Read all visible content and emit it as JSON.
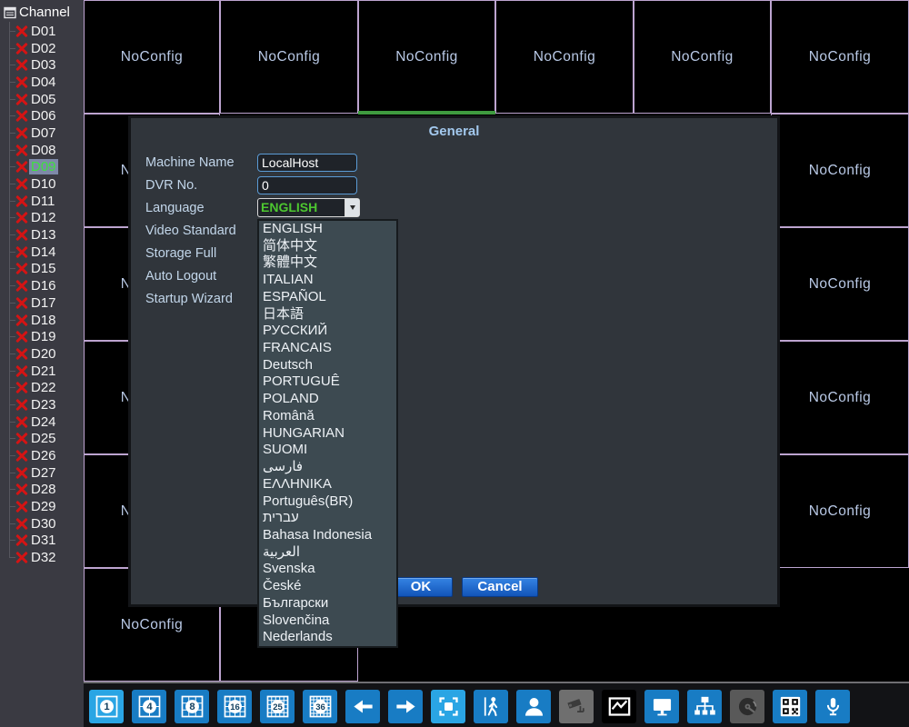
{
  "sidebar": {
    "title": "Channel",
    "selected": "D09",
    "channels": [
      "D01",
      "D02",
      "D03",
      "D04",
      "D05",
      "D06",
      "D07",
      "D08",
      "D09",
      "D10",
      "D11",
      "D12",
      "D13",
      "D14",
      "D15",
      "D16",
      "D17",
      "D18",
      "D19",
      "D20",
      "D21",
      "D22",
      "D23",
      "D24",
      "D25",
      "D26",
      "D27",
      "D28",
      "D29",
      "D30",
      "D31",
      "D32"
    ]
  },
  "grid": {
    "no_config_label": "NoConfig",
    "selected_cell": {
      "r": 2,
      "c": 3
    },
    "cells": [
      {
        "r": 1,
        "c": 1,
        "label": true
      },
      {
        "r": 1,
        "c": 2,
        "label": true
      },
      {
        "r": 1,
        "c": 3,
        "label": true
      },
      {
        "r": 1,
        "c": 4,
        "label": true
      },
      {
        "r": 1,
        "c": 5,
        "label": true
      },
      {
        "r": 1,
        "c": 6,
        "label": true
      },
      {
        "r": 2,
        "c": 1,
        "label": true
      },
      {
        "r": 2,
        "c": 6,
        "label": true
      },
      {
        "r": 3,
        "c": 1,
        "label": true
      },
      {
        "r": 3,
        "c": 6,
        "label": true
      },
      {
        "r": 4,
        "c": 1,
        "label": true
      },
      {
        "r": 4,
        "c": 6,
        "label": true
      },
      {
        "r": 5,
        "c": 1,
        "label": true
      },
      {
        "r": 5,
        "c": 6,
        "label": true
      },
      {
        "r": 6,
        "c": 1,
        "label": true
      },
      {
        "r": 6,
        "c": 2,
        "label": false
      }
    ]
  },
  "dialog": {
    "title": "General",
    "fields": [
      {
        "name": "machine-name",
        "label": "Machine Name",
        "type": "input",
        "value": "LocalHost"
      },
      {
        "name": "dvr-no",
        "label": "DVR No.",
        "type": "input",
        "value": "0"
      },
      {
        "name": "language",
        "label": "Language",
        "type": "combo",
        "value": "ENGLISH"
      },
      {
        "name": "video-standard",
        "label": "Video Standard",
        "type": "hidden"
      },
      {
        "name": "storage-full",
        "label": "Storage Full",
        "type": "hidden"
      },
      {
        "name": "auto-logout",
        "label": "Auto Logout",
        "type": "hidden"
      },
      {
        "name": "startup-wizard",
        "label": "Startup Wizard",
        "type": "hidden"
      }
    ],
    "buttons": {
      "ok": "OK",
      "cancel": "Cancel"
    }
  },
  "language_dropdown": {
    "items": [
      "ENGLISH",
      "简体中文",
      "繁體中文",
      "ITALIAN",
      "ESPAÑOL",
      "日本語",
      "РУССКИЙ",
      "FRANCAIS",
      "Deutsch",
      "PORTUGUÊ",
      "POLAND",
      "Română",
      "HUNGARIAN",
      "SUOMI",
      "فارسى",
      "ΕΛΛΗΝΙΚΑ",
      "Português(BR)",
      "עברית",
      "Bahasa Indonesia",
      "العربية",
      "Svenska",
      "České",
      "Български",
      "Slovenčina",
      "Nederlands"
    ]
  },
  "toolbar": {
    "buttons": [
      {
        "name": "view-1",
        "icon": "grid",
        "label": "1",
        "variant": "hi"
      },
      {
        "name": "view-4",
        "icon": "grid",
        "label": "4",
        "variant": "blue"
      },
      {
        "name": "view-8",
        "icon": "grid",
        "label": "8",
        "variant": "blue"
      },
      {
        "name": "view-16",
        "icon": "grid",
        "label": "16",
        "variant": "blue"
      },
      {
        "name": "view-25",
        "icon": "grid",
        "label": "25",
        "variant": "blue"
      },
      {
        "name": "view-36",
        "icon": "grid",
        "label": "36",
        "variant": "blue"
      },
      {
        "name": "prev-page",
        "icon": "arrow-left",
        "variant": "blue"
      },
      {
        "name": "next-page",
        "icon": "arrow-right",
        "variant": "blue"
      },
      {
        "name": "fullscreen",
        "icon": "fullscreen",
        "variant": "hi"
      },
      {
        "name": "motion-detect",
        "icon": "walker",
        "variant": "blue"
      },
      {
        "name": "face-detect",
        "icon": "person",
        "variant": "blue"
      },
      {
        "name": "camera",
        "icon": "camera",
        "variant": "gray"
      },
      {
        "name": "bitrate-chart",
        "icon": "chart",
        "variant": "chart"
      },
      {
        "name": "monitor",
        "icon": "monitor",
        "variant": "blue"
      },
      {
        "name": "network",
        "icon": "network",
        "variant": "blue"
      },
      {
        "name": "hard-disk",
        "icon": "disk",
        "variant": "darkgray"
      },
      {
        "name": "qr-code",
        "icon": "qr",
        "variant": "blue"
      },
      {
        "name": "microphone",
        "icon": "mic",
        "variant": "blue"
      }
    ]
  },
  "colors": {
    "grid_line": "#bda4d0",
    "selection_green": "#3f9b3f",
    "channel_selected_text": "#3ee23e",
    "language_value_green": "#4dc730",
    "no_config_text": "#b9c9e6",
    "toolbar_blue": "#187cc4",
    "toolbar_highlight_blue": "#2aa5e4",
    "button_blue": "#1254b8"
  }
}
